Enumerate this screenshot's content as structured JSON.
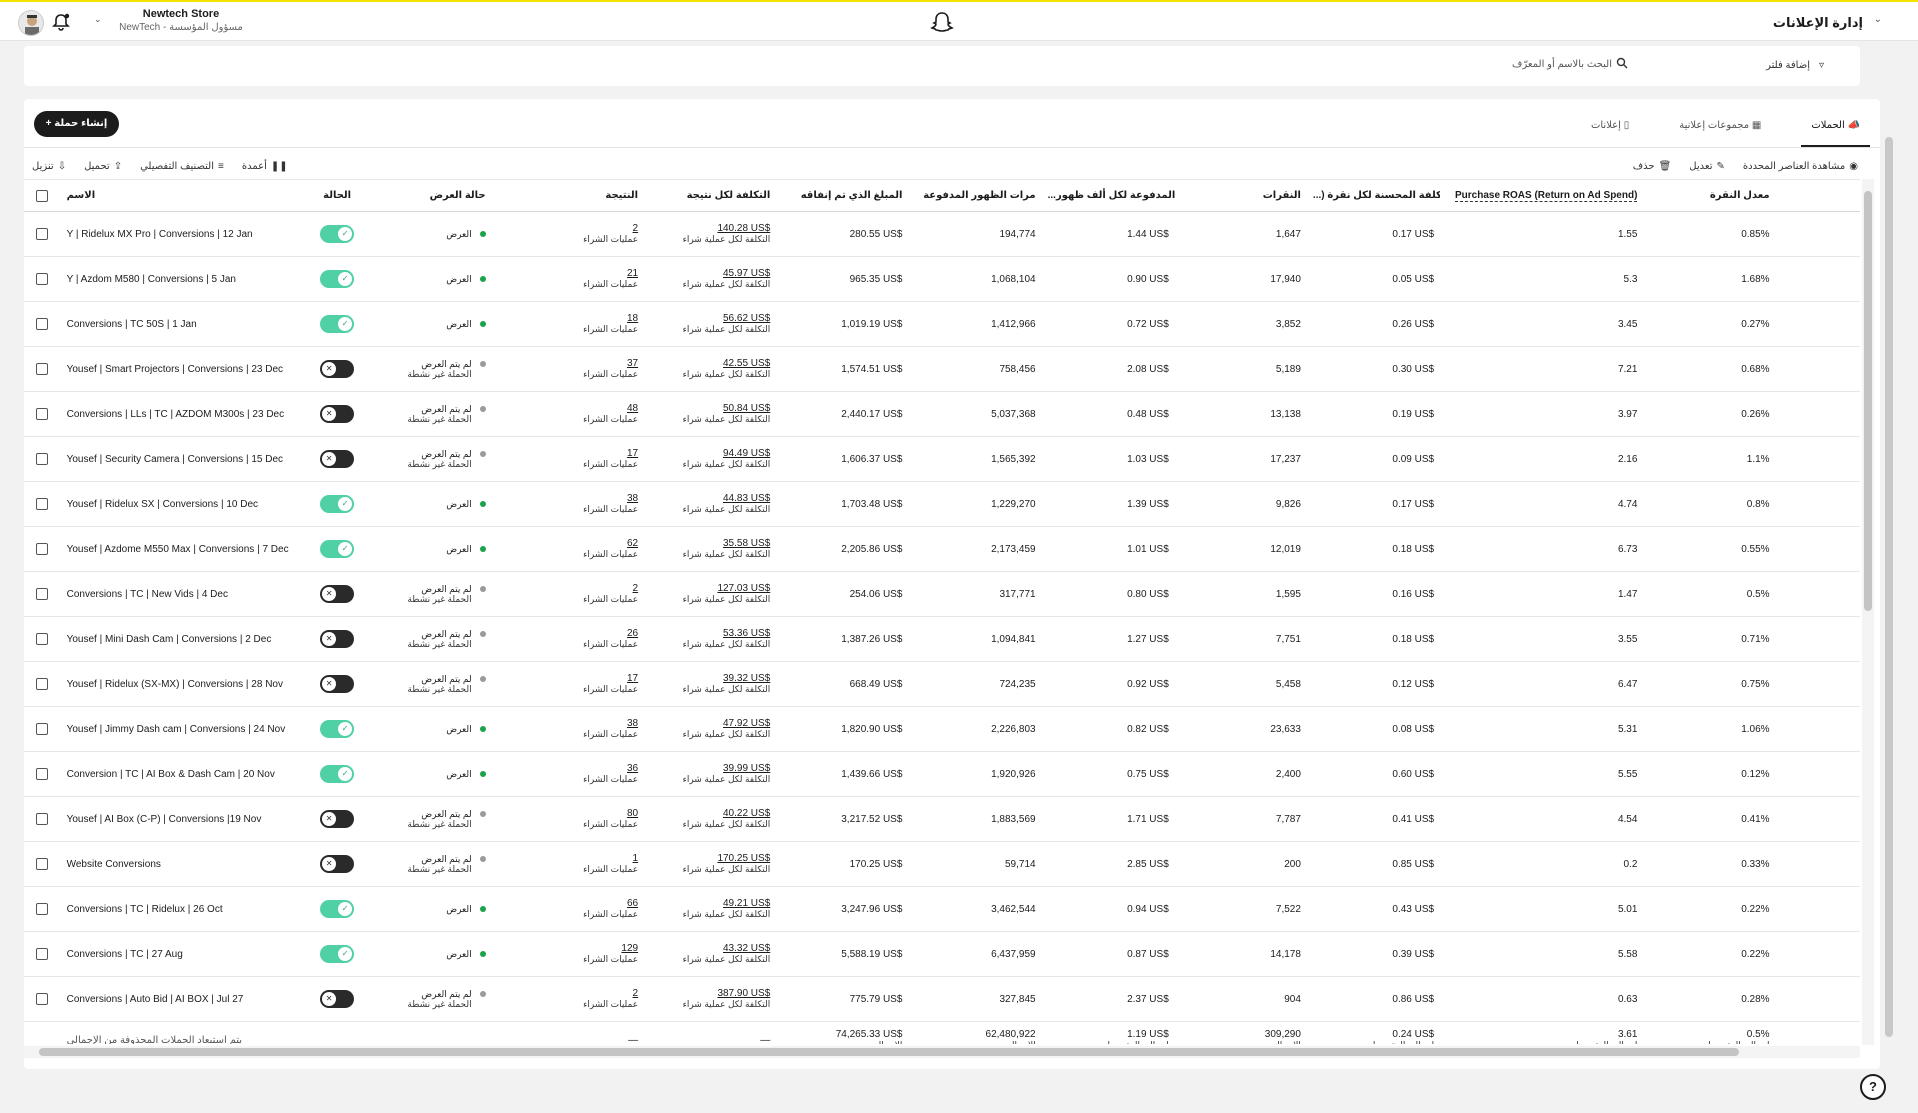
{
  "topbar": {
    "title": "إدارة الإعلانات",
    "store_name": "Newtech Store",
    "store_role": "مسؤول المؤسسة - NewTech"
  },
  "filters": {
    "add_filter": "إضافة فلتر",
    "search_placeholder": "البحث بالاسم أو المعرّف"
  },
  "actions": {
    "create_campaign": "إنشاء حملة"
  },
  "tabs": [
    {
      "label": "الحملات",
      "active": true
    },
    {
      "label": "مجموعات إعلانية",
      "active": false
    },
    {
      "label": "إعلانات",
      "active": false
    }
  ],
  "toolbar": {
    "view_selected": "مشاهدة العناصر المحددة",
    "edit": "تعديل",
    "delete": "حذف",
    "columns": "أعمدة",
    "breakdown": "التصنيف التفصيلي",
    "upload": "تحميل",
    "download": "تنزيل"
  },
  "columns": {
    "name": "الاسم",
    "status": "الحالة",
    "delivery": "حالة العرض",
    "result": "النتيجة",
    "cost_per_result": "التكلفة لكل نتيجة",
    "spend": "المبلغ الذي تم إنفاقه",
    "impressions": "مرات الظهور المدفوعة",
    "cpm": "...ية المدفوعة لكل ألف ظهور",
    "swipes": "النقرات",
    "cost_per_swipe": "...) التكلفة المحسنة لكل نقرة",
    "roas": "Purchase ROAS (Return on Ad Spend)",
    "ctr": "معدل النقرة"
  },
  "labels": {
    "delivering": "العرض",
    "not_delivering": "لم يتم العرض",
    "inactive_campaign": "الحملة غير نشطة",
    "purchases": "عمليات الشراء",
    "cost_per_purchase": "التكلفة لكل عملية شراء",
    "total": "الإجمالي",
    "average_total": "إجمالي المتوسط",
    "footer_note": "يتم استبعاد الحملات المحذوفة من الإجمالي",
    "dash": "—"
  },
  "rows": [
    {
      "name": "Y | Ridelux MX Pro | Conversions | 12 Jan",
      "active": true,
      "result": "2",
      "cpr": "140.28 US$",
      "spend": "280.55 US$",
      "imp": "194,774",
      "cpm": "1.44 US$",
      "swipes": "1,647",
      "cps": "0.17 US$",
      "roas": "1.55",
      "ctr": "0.85%"
    },
    {
      "name": "Y | Azdom M580 | Conversions | 5 Jan",
      "active": true,
      "result": "21",
      "cpr": "45.97 US$",
      "spend": "965.35 US$",
      "imp": "1,068,104",
      "cpm": "0.90 US$",
      "swipes": "17,940",
      "cps": "0.05 US$",
      "roas": "5.3",
      "ctr": "1.68%"
    },
    {
      "name": "Conversions | TC 50S | 1 Jan",
      "active": true,
      "result": "18",
      "cpr": "56.62 US$",
      "spend": "1,019.19 US$",
      "imp": "1,412,966",
      "cpm": "0.72 US$",
      "swipes": "3,852",
      "cps": "0.26 US$",
      "roas": "3.45",
      "ctr": "0.27%"
    },
    {
      "name": "Yousef | Smart Projectors | Conversions | 23 Dec",
      "active": false,
      "result": "37",
      "cpr": "42.55 US$",
      "spend": "1,574.51 US$",
      "imp": "758,456",
      "cpm": "2.08 US$",
      "swipes": "5,189",
      "cps": "0.30 US$",
      "roas": "7.21",
      "ctr": "0.68%"
    },
    {
      "name": "Conversions | LLs | TC | AZDOM M300s | 23 Dec",
      "active": false,
      "result": "48",
      "cpr": "50.84 US$",
      "spend": "2,440.17 US$",
      "imp": "5,037,368",
      "cpm": "0.48 US$",
      "swipes": "13,138",
      "cps": "0.19 US$",
      "roas": "3.97",
      "ctr": "0.26%"
    },
    {
      "name": "Yousef | Security Camera | Conversions | 15 Dec",
      "active": false,
      "result": "17",
      "cpr": "94.49 US$",
      "spend": "1,606.37 US$",
      "imp": "1,565,392",
      "cpm": "1.03 US$",
      "swipes": "17,237",
      "cps": "0.09 US$",
      "roas": "2.16",
      "ctr": "1.1%"
    },
    {
      "name": "Yousef | Ridelux SX | Conversions | 10 Dec",
      "active": true,
      "result": "38",
      "cpr": "44.83 US$",
      "spend": "1,703.48 US$",
      "imp": "1,229,270",
      "cpm": "1.39 US$",
      "swipes": "9,826",
      "cps": "0.17 US$",
      "roas": "4.74",
      "ctr": "0.8%"
    },
    {
      "name": "Yousef | Azdome M550 Max | Conversions | 7 Dec",
      "active": true,
      "result": "62",
      "cpr": "35.58 US$",
      "spend": "2,205.86 US$",
      "imp": "2,173,459",
      "cpm": "1.01 US$",
      "swipes": "12,019",
      "cps": "0.18 US$",
      "roas": "6.73",
      "ctr": "0.55%"
    },
    {
      "name": "Conversions | TC | New Vids | 4 Dec",
      "active": false,
      "result": "2",
      "cpr": "127.03 US$",
      "spend": "254.06 US$",
      "imp": "317,771",
      "cpm": "0.80 US$",
      "swipes": "1,595",
      "cps": "0.16 US$",
      "roas": "1.47",
      "ctr": "0.5%"
    },
    {
      "name": "Yousef | Mini Dash Cam | Conversions | 2 Dec",
      "active": false,
      "result": "26",
      "cpr": "53.36 US$",
      "spend": "1,387.26 US$",
      "imp": "1,094,841",
      "cpm": "1.27 US$",
      "swipes": "7,751",
      "cps": "0.18 US$",
      "roas": "3.55",
      "ctr": "0.71%"
    },
    {
      "name": "Yousef | Ridelux (SX-MX) | Conversions | 28 Nov",
      "active": false,
      "result": "17",
      "cpr": "39.32 US$",
      "spend": "668.49 US$",
      "imp": "724,235",
      "cpm": "0.92 US$",
      "swipes": "5,458",
      "cps": "0.12 US$",
      "roas": "6.47",
      "ctr": "0.75%"
    },
    {
      "name": "Yousef | Jimmy Dash cam | Conversions | 24 Nov",
      "active": true,
      "result": "38",
      "cpr": "47.92 US$",
      "spend": "1,820.90 US$",
      "imp": "2,226,803",
      "cpm": "0.82 US$",
      "swipes": "23,633",
      "cps": "0.08 US$",
      "roas": "5.31",
      "ctr": "1.06%"
    },
    {
      "name": "Conversion | TC | AI Box & Dash Cam | 20 Nov",
      "active": true,
      "result": "36",
      "cpr": "39.99 US$",
      "spend": "1,439.66 US$",
      "imp": "1,920,926",
      "cpm": "0.75 US$",
      "swipes": "2,400",
      "cps": "0.60 US$",
      "roas": "5.55",
      "ctr": "0.12%"
    },
    {
      "name": "Yousef | AI Box (C-P) | Conversions |19 Nov",
      "active": false,
      "result": "80",
      "cpr": "40.22 US$",
      "spend": "3,217.52 US$",
      "imp": "1,883,569",
      "cpm": "1.71 US$",
      "swipes": "7,787",
      "cps": "0.41 US$",
      "roas": "4.54",
      "ctr": "0.41%"
    },
    {
      "name": "Website Conversions",
      "active": false,
      "result": "1",
      "cpr": "170.25 US$",
      "spend": "170.25 US$",
      "imp": "59,714",
      "cpm": "2.85 US$",
      "swipes": "200",
      "cps": "0.85 US$",
      "roas": "0.2",
      "ctr": "0.33%"
    },
    {
      "name": "Conversions | TC | Ridelux | 26 Oct",
      "active": true,
      "result": "66",
      "cpr": "49.21 US$",
      "spend": "3,247.96 US$",
      "imp": "3,462,544",
      "cpm": "0.94 US$",
      "swipes": "7,522",
      "cps": "0.43 US$",
      "roas": "5.01",
      "ctr": "0.22%"
    },
    {
      "name": "Conversions | TC | 27 Aug",
      "active": true,
      "result": "129",
      "cpr": "43.32 US$",
      "spend": "5,588.19 US$",
      "imp": "6,437,959",
      "cpm": "0.87 US$",
      "swipes": "14,178",
      "cps": "0.39 US$",
      "roas": "5.58",
      "ctr": "0.22%"
    },
    {
      "name": "Conversions | Auto Bid | AI BOX | Jul 27",
      "active": false,
      "result": "2",
      "cpr": "387.90 US$",
      "spend": "775.79 US$",
      "imp": "327,845",
      "cpm": "2.37 US$",
      "swipes": "904",
      "cps": "0.86 US$",
      "roas": "0.63",
      "ctr": "0.28%"
    }
  ],
  "totals": {
    "result": "—",
    "cpr": "—",
    "spend": "74,265.33 US$",
    "imp": "62,480,922",
    "cpm": "1.19 US$",
    "swipes": "309,290",
    "cps": "0.24 US$",
    "roas": "3.61",
    "ctr": "0.5%"
  },
  "colors": {
    "accent_yellow": "#f5e400",
    "toggle_on": "#4fd1a5",
    "toggle_off": "#2a2a2a",
    "delivering_dot": "#1aa34a"
  }
}
